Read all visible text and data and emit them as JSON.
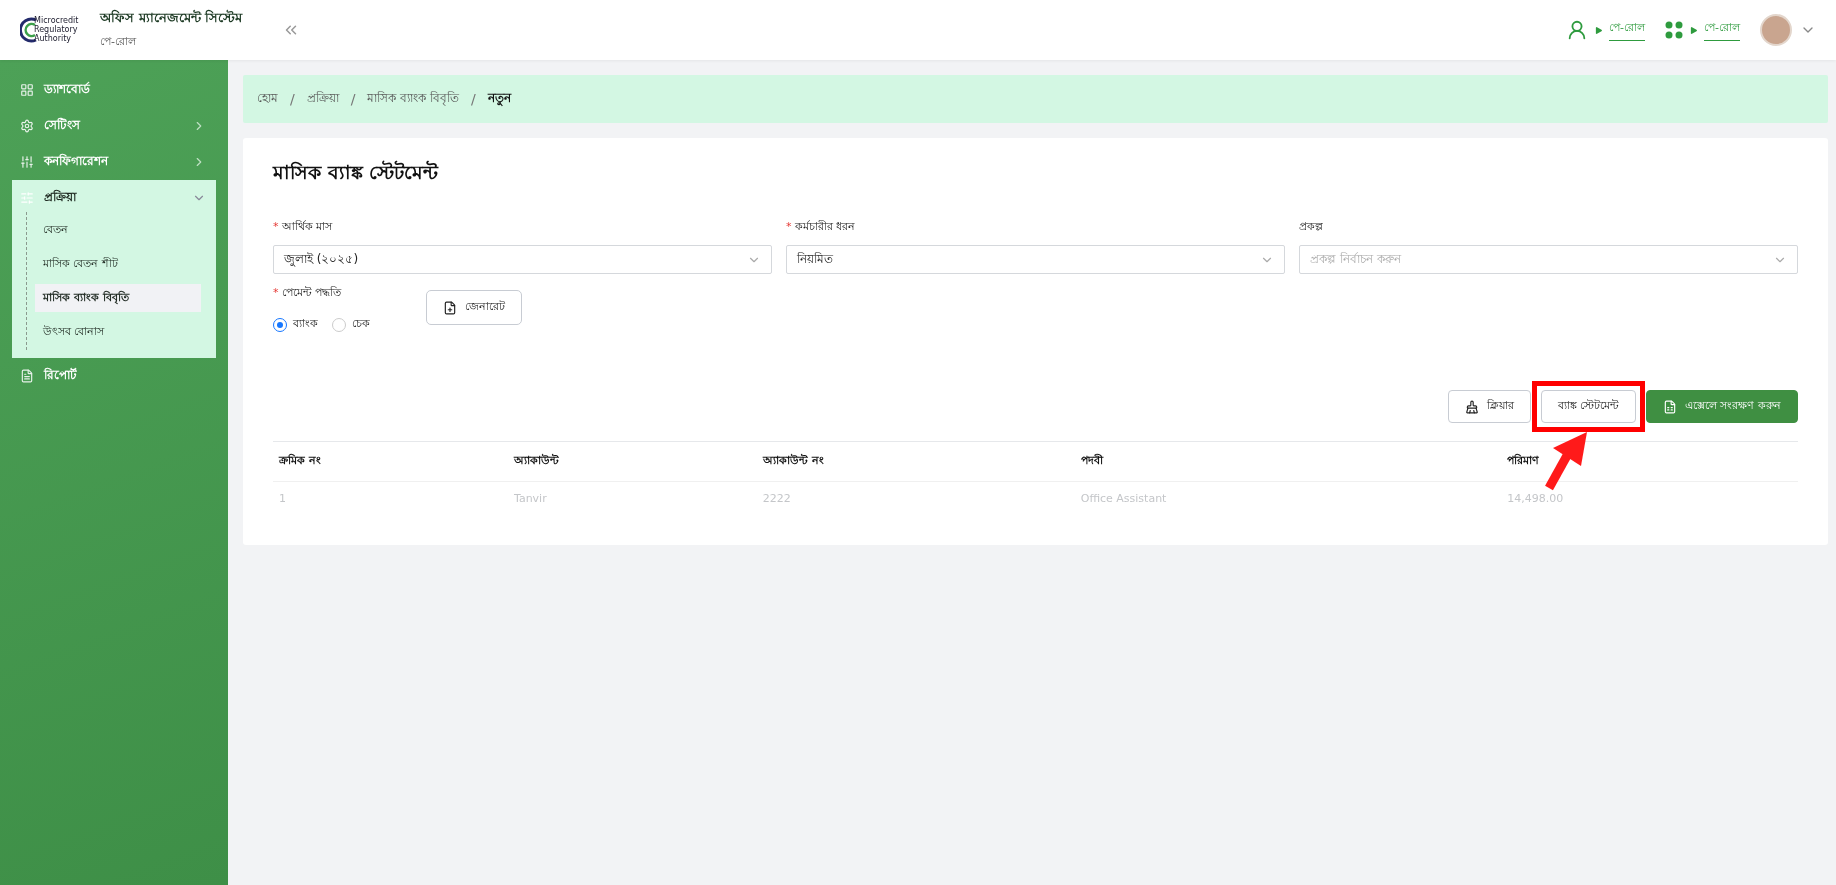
{
  "header": {
    "logo_lines": [
      "Microcredit",
      "Regulatory",
      "Authority"
    ],
    "app_title": "অফিস ম্যানেজমেন্ট সিস্টেম",
    "app_subtitle": "পে-রোল",
    "links": [
      {
        "kind": "user-switch",
        "label": "পে-রোল"
      },
      {
        "kind": "grid",
        "label": "পে-রোল"
      }
    ]
  },
  "sidebar": {
    "items": [
      {
        "kind": "link",
        "label": "ড্যাশবোর্ড"
      },
      {
        "kind": "group",
        "label": "সেটিংস",
        "expanded": false
      },
      {
        "kind": "group",
        "label": "কনফিগারেশন",
        "expanded": false
      },
      {
        "kind": "group",
        "label": "প্রক্রিয়া",
        "expanded": true,
        "children": [
          {
            "label": "বেতন",
            "selected": false
          },
          {
            "label": "মাসিক বেতন শীট",
            "selected": false
          },
          {
            "label": "মাসিক ব্যাংক বিবৃতি",
            "selected": true
          },
          {
            "label": "উৎসব বোনাস",
            "selected": false
          }
        ]
      },
      {
        "kind": "link",
        "label": "রিপোর্ট"
      }
    ]
  },
  "breadcrumb_separator": "/",
  "required_mark": "*",
  "breadcrumb": [
    {
      "label": "হোম",
      "current": false
    },
    {
      "label": "প্রক্রিয়া",
      "current": false
    },
    {
      "label": "মাসিক ব্যাংক বিবৃতি",
      "current": false
    },
    {
      "label": "নতুন",
      "current": true
    }
  ],
  "form": {
    "title": "মাসিক ব্যাঙ্ক স্টেটমেন্ট",
    "fields": [
      {
        "label": "আর্থিক মাস",
        "required": true,
        "value": "জুলাই (২০২৫)"
      },
      {
        "label": "কর্মচারীর ধরন",
        "required": true,
        "value": "নিয়মিত"
      },
      {
        "label": "প্রকল্প",
        "required": false,
        "placeholder": "প্রকল্প নির্বাচন করুন"
      }
    ],
    "payment": {
      "label": "পেমেন্ট পদ্ধতি",
      "required": true,
      "options": [
        {
          "label": "ব্যাংক",
          "selected": true
        },
        {
          "label": "চেক",
          "selected": false
        }
      ]
    },
    "generate_button": "জেনারেট"
  },
  "actions": [
    {
      "kind": "clear",
      "label": "ক্লিয়ার",
      "highlighted": false
    },
    {
      "kind": "plain",
      "label": "ব্যাঙ্ক স্টেটমেন্ট",
      "highlighted": true
    },
    {
      "kind": "excel",
      "label": "এক্সেলে সংরক্ষণ করুন",
      "highlighted": false
    }
  ],
  "table": {
    "columns": [
      "ক্রমিক নং",
      "অ্যাকাউন্ট",
      "অ্যাকাউন্ট নং",
      "পদবী",
      "পরিমাণ"
    ],
    "rows": [
      [
        "1",
        "Tanvir",
        "2222",
        "Office Assistant",
        "14,498.00"
      ]
    ]
  }
}
